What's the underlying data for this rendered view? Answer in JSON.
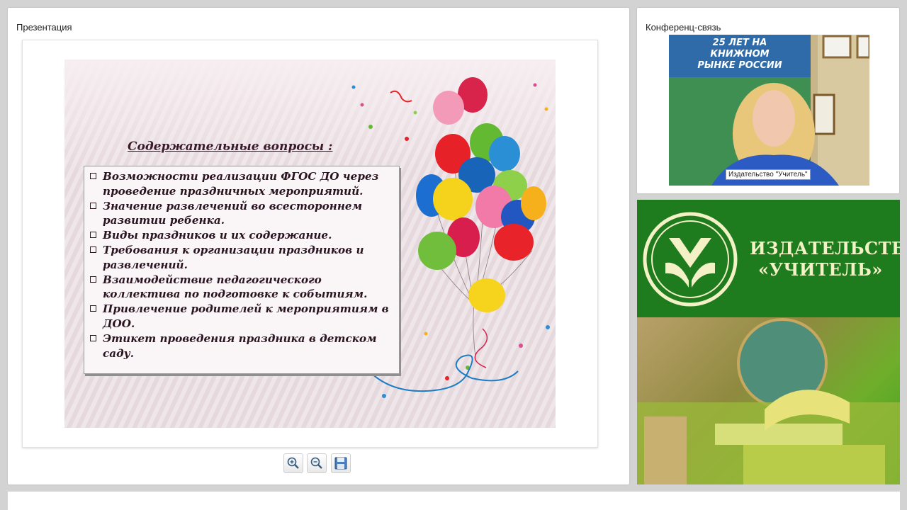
{
  "presentation": {
    "title": "Презентация",
    "slide": {
      "heading": "Содержательные вопросы :",
      "items": [
        "Возможности реализации ФГОС ДО через проведение праздничных мероприятий.",
        "Значение развлечений во всестороннем развитии ребенка.",
        "Виды праздников и их содержание.",
        "Требования к организации праздников и развлечений.",
        "Взаимодействие педагогического коллектива по подготовке к событиям.",
        "Привлечение родителей к мероприятиям в ДОО.",
        "Этикет проведения праздника в детском саду."
      ]
    },
    "toolbar": {
      "zoom_in": "zoom-in-icon",
      "zoom_out": "zoom-out-icon",
      "save": "save-icon"
    }
  },
  "conference": {
    "title": "Конференц-связь",
    "video_caption": "Издательство \"Учитель\"",
    "backdrop_text": "25 ЛЕТ НА КНИЖНОМ РЫНКЕ РОССИИ"
  },
  "publisher": {
    "name_line1": "ИЗДАТЕЛЬСТВО",
    "name_line2": "«УЧИТЕЛЬ»"
  },
  "colors": {
    "background": "#d3d3d3",
    "publisher_green": "#1e7b1e",
    "publisher_text": "#f4f1c6"
  }
}
